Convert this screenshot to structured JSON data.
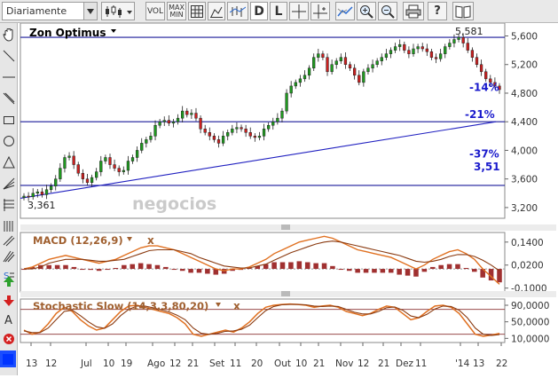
{
  "toolbar": {
    "period_label": "Diariamente",
    "vol_label": "VOL",
    "maxmin_line1": "MAX",
    "maxmin_line2": "MIN",
    "d_label": "D",
    "l_label": "L",
    "help_label": "?"
  },
  "watermark": "negocios",
  "chart_data": [
    {
      "type": "line",
      "title": "Zon Optimus",
      "y_ticks": [
        "5,600",
        "5,200",
        "4,800",
        "4,400",
        "4,000",
        "3,600",
        "3,200"
      ],
      "y_tick_values": [
        5.6,
        5.2,
        4.8,
        4.4,
        4.0,
        3.6,
        3.2
      ],
      "ylim": [
        3.05,
        5.78
      ],
      "x_ticks": [
        "13",
        "12",
        "Jul",
        "10",
        "19",
        "Ago",
        "12",
        "21",
        "Set",
        "11",
        "20",
        "Out",
        "10",
        "21",
        "Nov",
        "12",
        "21",
        "Dez",
        "11",
        "'14",
        "13",
        "22"
      ],
      "series": [
        {
          "values": [
            3.36,
            3.35,
            3.4,
            3.42,
            3.38,
            3.45,
            3.5,
            3.6,
            3.75,
            3.9,
            3.92,
            3.8,
            3.68,
            3.6,
            3.55,
            3.62,
            3.7,
            3.85,
            3.9,
            3.8,
            3.75,
            3.7,
            3.72,
            3.85,
            3.9,
            4.0,
            4.1,
            4.15,
            4.2,
            4.35,
            4.4,
            4.42,
            4.38,
            4.4,
            4.45,
            4.55,
            4.5,
            4.52,
            4.45,
            4.3,
            4.25,
            4.2,
            4.15,
            4.1,
            4.2,
            4.25,
            4.3,
            4.32,
            4.3,
            4.25,
            4.2,
            4.18,
            4.2,
            4.3,
            4.35,
            4.4,
            4.45,
            4.55,
            4.8,
            4.9,
            4.95,
            5.0,
            5.05,
            5.15,
            5.3,
            5.35,
            5.3,
            5.1,
            5.2,
            5.25,
            5.3,
            5.2,
            5.15,
            5.05,
            4.95,
            5.1,
            5.15,
            5.2,
            5.25,
            5.3,
            5.35,
            5.4,
            5.45,
            5.48,
            5.4,
            5.35,
            5.42,
            5.45,
            5.42,
            5.38,
            5.3,
            5.28,
            5.35,
            5.45,
            5.5,
            5.55,
            5.58,
            5.5,
            5.4,
            5.3,
            5.2,
            5.1,
            5.0,
            4.95,
            4.9,
            4.85
          ]
        }
      ],
      "annotations": [
        {
          "text": "5,581",
          "value": 5.581
        },
        {
          "text": "3,361",
          "value": 3.361
        },
        {
          "text": "-14%",
          "value": 4.83
        },
        {
          "text": "-21%",
          "value": 4.45
        },
        {
          "text": "-37%",
          "value": 3.9
        },
        {
          "text": "3,51",
          "value": 3.72
        }
      ],
      "horizontal_lines": [
        5.581,
        4.4,
        3.51
      ],
      "trendline": {
        "from": 3.33,
        "to": 4.4
      }
    },
    {
      "type": "line",
      "title": "MACD (12,26,9)",
      "y_ticks": [
        "0,1400",
        "0,0200",
        "-0,1000"
      ],
      "y_tick_values": [
        0.14,
        0.02,
        -0.1
      ],
      "ylim": [
        -0.12,
        0.19
      ],
      "series": [
        {
          "values": [
            0.0,
            0.01,
            0.03,
            0.05,
            0.06,
            0.07,
            0.06,
            0.05,
            0.04,
            0.03,
            0.04,
            0.05,
            0.07,
            0.09,
            0.11,
            0.12,
            0.12,
            0.11,
            0.1,
            0.08,
            0.06,
            0.04,
            0.02,
            0.0,
            -0.01,
            0.0,
            0.0,
            0.01,
            0.03,
            0.05,
            0.08,
            0.1,
            0.12,
            0.14,
            0.15,
            0.16,
            0.17,
            0.16,
            0.14,
            0.12,
            0.1,
            0.09,
            0.08,
            0.07,
            0.06,
            0.04,
            0.02,
            0.0,
            0.02,
            0.05,
            0.07,
            0.09,
            0.1,
            0.08,
            0.05,
            0.0,
            -0.04,
            -0.08
          ]
        },
        {
          "values": [
            0.0,
            0.0,
            0.01,
            0.03,
            0.04,
            0.05,
            0.05,
            0.05,
            0.045,
            0.04,
            0.04,
            0.045,
            0.05,
            0.065,
            0.08,
            0.095,
            0.1,
            0.1,
            0.1,
            0.09,
            0.08,
            0.06,
            0.045,
            0.03,
            0.015,
            0.01,
            0.005,
            0.005,
            0.015,
            0.025,
            0.045,
            0.065,
            0.085,
            0.1,
            0.115,
            0.13,
            0.14,
            0.145,
            0.14,
            0.13,
            0.12,
            0.11,
            0.1,
            0.09,
            0.08,
            0.07,
            0.055,
            0.04,
            0.035,
            0.04,
            0.05,
            0.065,
            0.075,
            0.075,
            0.065,
            0.045,
            0.02,
            -0.01
          ]
        }
      ],
      "histogram": [
        0.0,
        0.01,
        0.02,
        0.02,
        0.02,
        0.02,
        0.01,
        0.0,
        -0.005,
        -0.01,
        0.0,
        0.005,
        0.02,
        0.025,
        0.03,
        0.025,
        0.02,
        0.01,
        0.0,
        -0.01,
        -0.02,
        -0.02,
        -0.025,
        -0.03,
        -0.025,
        -0.01,
        -0.005,
        0.005,
        0.015,
        0.025,
        0.035,
        0.035,
        0.035,
        0.04,
        0.035,
        0.03,
        0.03,
        0.015,
        0.0,
        -0.01,
        -0.02,
        -0.02,
        -0.02,
        -0.02,
        -0.02,
        -0.03,
        -0.035,
        -0.04,
        -0.015,
        0.01,
        0.02,
        0.025,
        0.025,
        0.005,
        -0.015,
        -0.045,
        -0.06,
        -0.07
      ]
    },
    {
      "type": "line",
      "title": "Stochastic Slow (14,3,3,80,20)",
      "y_ticks": [
        "90,0000",
        "50,0000",
        "10,0000"
      ],
      "y_tick_values": [
        90,
        50,
        10
      ],
      "ylim": [
        0,
        105
      ],
      "series": [
        {
          "values": [
            30,
            20,
            25,
            45,
            70,
            85,
            75,
            55,
            40,
            30,
            35,
            55,
            75,
            88,
            90,
            85,
            80,
            75,
            70,
            60,
            45,
            20,
            15,
            20,
            25,
            30,
            25,
            35,
            50,
            70,
            85,
            90,
            92,
            93,
            92,
            90,
            85,
            88,
            90,
            85,
            75,
            70,
            65,
            70,
            80,
            88,
            85,
            70,
            55,
            60,
            75,
            88,
            90,
            85,
            70,
            45,
            20,
            15,
            18,
            22
          ]
        },
        {
          "values": [
            28,
            24,
            24,
            35,
            55,
            75,
            78,
            65,
            50,
            38,
            34,
            45,
            65,
            80,
            88,
            88,
            84,
            79,
            74,
            66,
            55,
            35,
            22,
            20,
            22,
            27,
            28,
            32,
            42,
            60,
            77,
            87,
            91,
            92,
            92,
            91,
            88,
            87,
            88,
            87,
            80,
            73,
            69,
            69,
            75,
            84,
            86,
            78,
            64,
            60,
            68,
            81,
            88,
            87,
            78,
            60,
            35,
            20,
            17,
            19
          ]
        }
      ],
      "levels": [
        80,
        20
      ]
    }
  ]
}
